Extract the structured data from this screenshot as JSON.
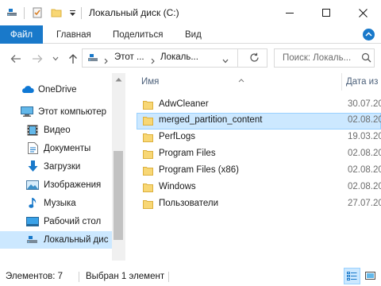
{
  "window": {
    "title": "Локальный диск (C:)",
    "accent_color": "#1979ca",
    "selection_color": "#cce8ff"
  },
  "quick_access": {
    "icons": [
      "drive-icon",
      "properties-check-icon",
      "new-folder-icon",
      "customize-chevron-icon"
    ]
  },
  "window_controls": [
    "minimize-icon",
    "maximize-icon",
    "close-icon"
  ],
  "ribbon": {
    "tabs": [
      {
        "label": "Файл",
        "active": true
      },
      {
        "label": "Главная",
        "active": false
      },
      {
        "label": "Поделиться",
        "active": false
      },
      {
        "label": "Вид",
        "active": false
      }
    ],
    "help_icon": "help-icon"
  },
  "address": {
    "breadcrumbs": [
      "Этот ...",
      "Локаль..."
    ],
    "search_placeholder": "Поиск: Локаль..."
  },
  "nav_pane": {
    "items": [
      {
        "label": "OneDrive",
        "icon": "onedrive-cloud-icon",
        "selected": false
      },
      {
        "label": "Этот компьютер",
        "icon": "computer-icon",
        "selected": false
      },
      {
        "label": "Видео",
        "icon": "video-folder-icon",
        "selected": false
      },
      {
        "label": "Документы",
        "icon": "documents-folder-icon",
        "selected": false
      },
      {
        "label": "Загрузки",
        "icon": "downloads-arrow-icon",
        "selected": false
      },
      {
        "label": "Изображения",
        "icon": "pictures-folder-icon",
        "selected": false
      },
      {
        "label": "Музыка",
        "icon": "music-note-icon",
        "selected": false
      },
      {
        "label": "Рабочий стол",
        "icon": "desktop-folder-icon",
        "selected": false
      },
      {
        "label": "Локальный дис",
        "icon": "local-disk-icon",
        "selected": true
      }
    ]
  },
  "file_list": {
    "columns": {
      "name": "Имя",
      "date": "Дата из"
    },
    "rows": [
      {
        "name": "AdwCleaner",
        "date": "30.07.20",
        "selected": false
      },
      {
        "name": "merged_partition_content",
        "date": "02.08.20",
        "selected": true
      },
      {
        "name": "PerfLogs",
        "date": "19.03.20",
        "selected": false
      },
      {
        "name": "Program Files",
        "date": "02.08.20",
        "selected": false
      },
      {
        "name": "Program Files (x86)",
        "date": "02.08.20",
        "selected": false
      },
      {
        "name": "Windows",
        "date": "02.08.20",
        "selected": false
      },
      {
        "name": "Пользователи",
        "date": "27.07.20",
        "selected": false
      }
    ]
  },
  "status_bar": {
    "item_count": "Элементов: 7",
    "selection": "Выбран 1 элемент"
  }
}
